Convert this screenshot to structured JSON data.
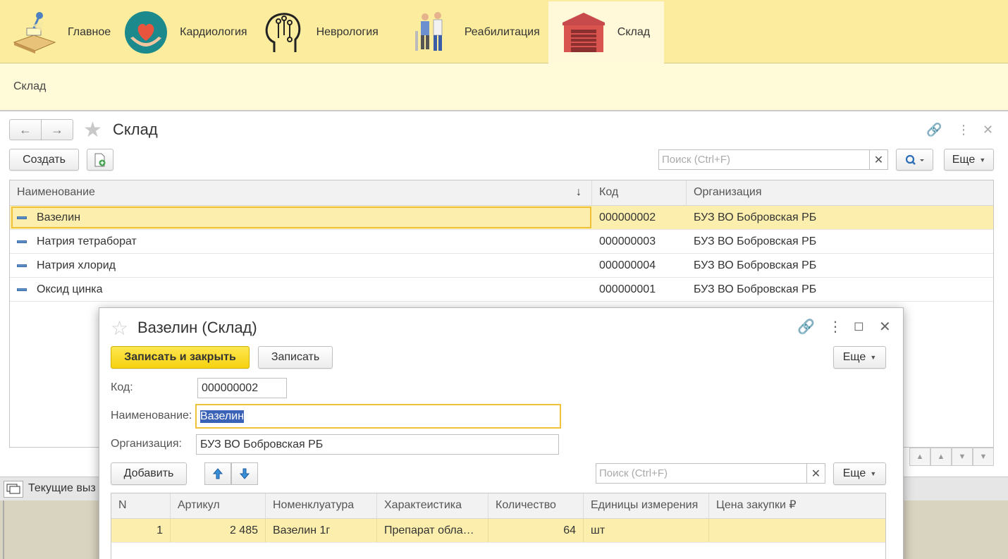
{
  "sections": [
    {
      "label": "Главное",
      "icon": "desk-lamp-icon"
    },
    {
      "label": "Кардиология",
      "icon": "heart-hands-icon"
    },
    {
      "label": "Неврология",
      "icon": "brain-circuit-icon"
    },
    {
      "label": "Реабилитация",
      "icon": "rehabilitation-icon"
    },
    {
      "label": "Склад",
      "icon": "warehouse-icon"
    }
  ],
  "breadcrumb": "Склад",
  "list": {
    "title": "Склад",
    "create_label": "Создать",
    "search_placeholder": "Поиск (Ctrl+F)",
    "more_label": "Еще",
    "columns": [
      "Наименование",
      "Код",
      "Организация"
    ],
    "rows": [
      {
        "name": "Вазелин",
        "code": "000000002",
        "org": "БУЗ ВО Бобровская РБ"
      },
      {
        "name": "Натрия тетраборат",
        "code": "000000003",
        "org": "БУЗ ВО Бобровская РБ"
      },
      {
        "name": "Натрия хлорид",
        "code": "000000004",
        "org": "БУЗ ВО Бобровская РБ"
      },
      {
        "name": "Оксид цинка",
        "code": "000000001",
        "org": "БУЗ ВО Бобровская РБ"
      }
    ]
  },
  "bottom_panel": {
    "label": "Текущие выз"
  },
  "dialog": {
    "title": "Вазелин (Склад)",
    "save_close_label": "Записать и закрыть",
    "save_label": "Записать",
    "more_label": "Еще",
    "code_label": "Код:",
    "code_value": "000000002",
    "name_label": "Наименование:",
    "name_value": "Вазелин",
    "org_label": "Организация:",
    "org_value": "БУЗ ВО Бобровская РБ",
    "add_label": "Добавить",
    "search_placeholder": "Поиск (Ctrl+F)",
    "more2_label": "Еще",
    "columns": [
      "N",
      "Артикул",
      "Номенклуатура",
      "Характеистика",
      "Количество",
      "Единицы измерения",
      "Цена закупки ₽"
    ],
    "rows": [
      {
        "n": "1",
        "article": "2 485",
        "nomenclature": "Вазелин 1г",
        "characteristic": "Препарат обла…",
        "qty": "64",
        "unit": "шт",
        "price": ""
      }
    ]
  }
}
